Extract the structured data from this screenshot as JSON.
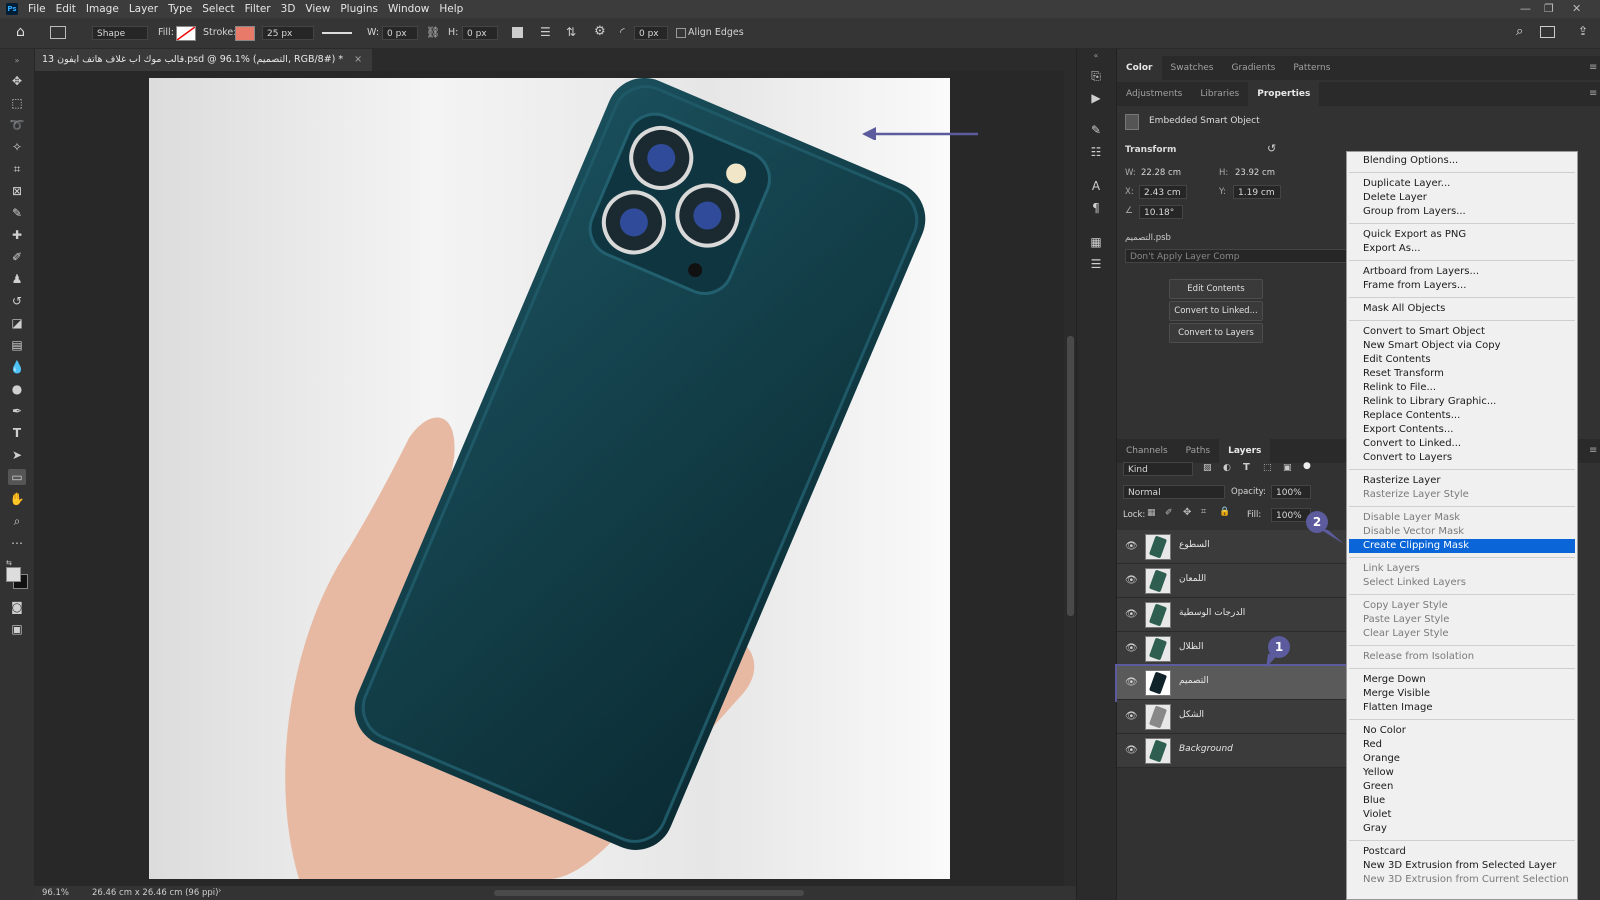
{
  "app": {
    "logo": "Ps"
  },
  "menu": [
    "File",
    "Edit",
    "Image",
    "Layer",
    "Type",
    "Select",
    "Filter",
    "3D",
    "View",
    "Plugins",
    "Window",
    "Help"
  ],
  "options_bar": {
    "mode": "Shape",
    "fill_label": "Fill:",
    "stroke_label": "Stroke:",
    "stroke_size": "25 px",
    "w_label": "W:",
    "w_value": "0 px",
    "h_label": "H:",
    "h_value": "0 px",
    "radius_value": "0 px",
    "align_edges": "Align Edges"
  },
  "document": {
    "tab_title": "قالب موك اب غلاف هاتف ايفون 13.psd @ 96.1% (التصميم, RGB/8#) *",
    "close": "×"
  },
  "status": {
    "zoom": "96.1%",
    "doc_size": "26.46 cm x 26.46 cm (96 ppi)"
  },
  "panel_top_tabs": [
    "Color",
    "Swatches",
    "Gradients",
    "Patterns"
  ],
  "panel_mid_tabs": [
    "Adjustments",
    "Libraries",
    "Properties"
  ],
  "properties": {
    "header": "Embedded Smart Object",
    "transform_label": "Transform",
    "w_label": "W:",
    "w_value": "22.28 cm",
    "h_label": "H:",
    "h_value": "23.92 cm",
    "x_label": "X:",
    "x_value": "2.43 cm",
    "y_label": "Y:",
    "y_value": "1.19 cm",
    "angle_value": "10.18°",
    "file_name": "التصميم.psb",
    "layer_comp": "Don't Apply Layer Comp",
    "buttons": [
      "Edit Contents",
      "Convert to Linked...",
      "Convert to Layers"
    ]
  },
  "layers_tabs": [
    "Channels",
    "Paths",
    "Layers"
  ],
  "layers_panel": {
    "kind": "Kind",
    "blend_mode": "Normal",
    "opacity_label": "Opacity:",
    "opacity_value": "100%",
    "lock_label": "Lock:",
    "fill_label": "Fill:",
    "fill_value": "100%",
    "layers": [
      "السطوع",
      "اللمعان",
      "الدرجات الوسطية",
      "الظلال",
      "التصميم",
      "الشكل",
      "Background"
    ],
    "selected_index": 4
  },
  "context_menu": {
    "groups": [
      [
        {
          "label": "Blending Options..."
        }
      ],
      [
        {
          "label": "Duplicate Layer..."
        },
        {
          "label": "Delete Layer"
        },
        {
          "label": "Group from Layers..."
        }
      ],
      [
        {
          "label": "Quick Export as PNG"
        },
        {
          "label": "Export As..."
        }
      ],
      [
        {
          "label": "Artboard from Layers..."
        },
        {
          "label": "Frame from Layers..."
        }
      ],
      [
        {
          "label": "Mask All Objects"
        }
      ],
      [
        {
          "label": "Convert to Smart Object"
        },
        {
          "label": "New Smart Object via Copy"
        },
        {
          "label": "Edit Contents"
        },
        {
          "label": "Reset Transform"
        },
        {
          "label": "Relink to File..."
        },
        {
          "label": "Relink to Library Graphic..."
        },
        {
          "label": "Replace Contents..."
        },
        {
          "label": "Export Contents..."
        },
        {
          "label": "Convert to Linked..."
        },
        {
          "label": "Convert to Layers"
        }
      ],
      [
        {
          "label": "Rasterize Layer"
        },
        {
          "label": "Rasterize Layer Style",
          "disabled": true
        }
      ],
      [
        {
          "label": "Disable Layer Mask",
          "disabled": true
        },
        {
          "label": "Disable Vector Mask",
          "disabled": true
        },
        {
          "label": "Create Clipping Mask",
          "highlighted": true
        }
      ],
      [
        {
          "label": "Link Layers",
          "disabled": true
        },
        {
          "label": "Select Linked Layers",
          "disabled": true
        }
      ],
      [
        {
          "label": "Copy Layer Style",
          "disabled": true
        },
        {
          "label": "Paste Layer Style",
          "disabled": true
        },
        {
          "label": "Clear Layer Style",
          "disabled": true
        }
      ],
      [
        {
          "label": "Release from Isolation",
          "disabled": true
        }
      ],
      [
        {
          "label": "Merge Down"
        },
        {
          "label": "Merge Visible"
        },
        {
          "label": "Flatten Image"
        }
      ],
      [
        {
          "label": "No Color"
        },
        {
          "label": "Red"
        },
        {
          "label": "Orange"
        },
        {
          "label": "Yellow"
        },
        {
          "label": "Green"
        },
        {
          "label": "Blue"
        },
        {
          "label": "Violet"
        },
        {
          "label": "Gray"
        }
      ],
      [
        {
          "label": "Postcard"
        },
        {
          "label": "New 3D Extrusion from Selected Layer"
        },
        {
          "label": "New 3D Extrusion from Current Selection",
          "disabled": true
        }
      ]
    ]
  },
  "annotations": {
    "badge1": "1",
    "badge2": "2",
    "accent": "#5b5b9e"
  },
  "colors": {
    "phone_case": "#123d47",
    "highlight": "#0a66d8"
  }
}
